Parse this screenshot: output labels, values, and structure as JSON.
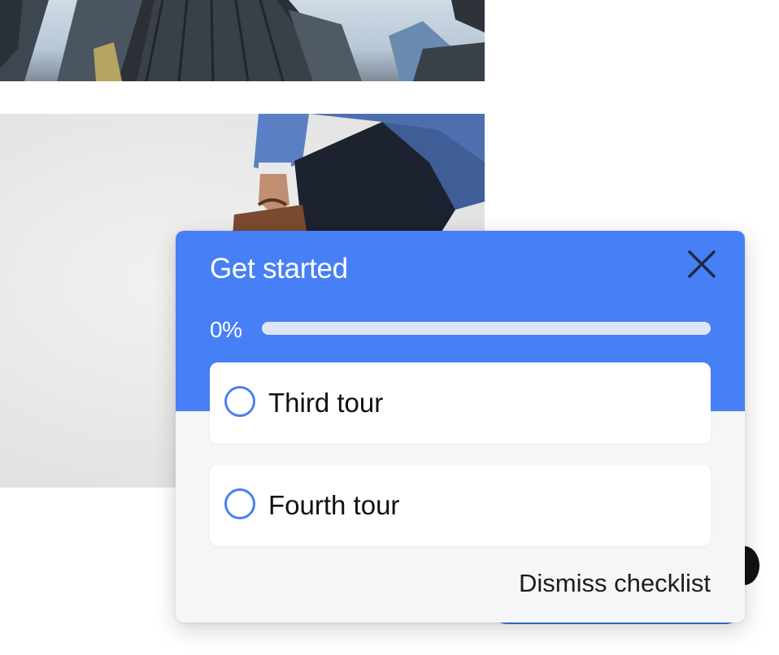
{
  "checklist": {
    "title": "Get started",
    "progress_text": "0%",
    "progress_value": 0,
    "accent_color": "#477ff6",
    "items": [
      {
        "label": "Third tour",
        "completed": false
      },
      {
        "label": "Fourth tour",
        "completed": false
      }
    ],
    "dismiss_label": "Dismiss checklist",
    "close_icon": "close-icon"
  }
}
